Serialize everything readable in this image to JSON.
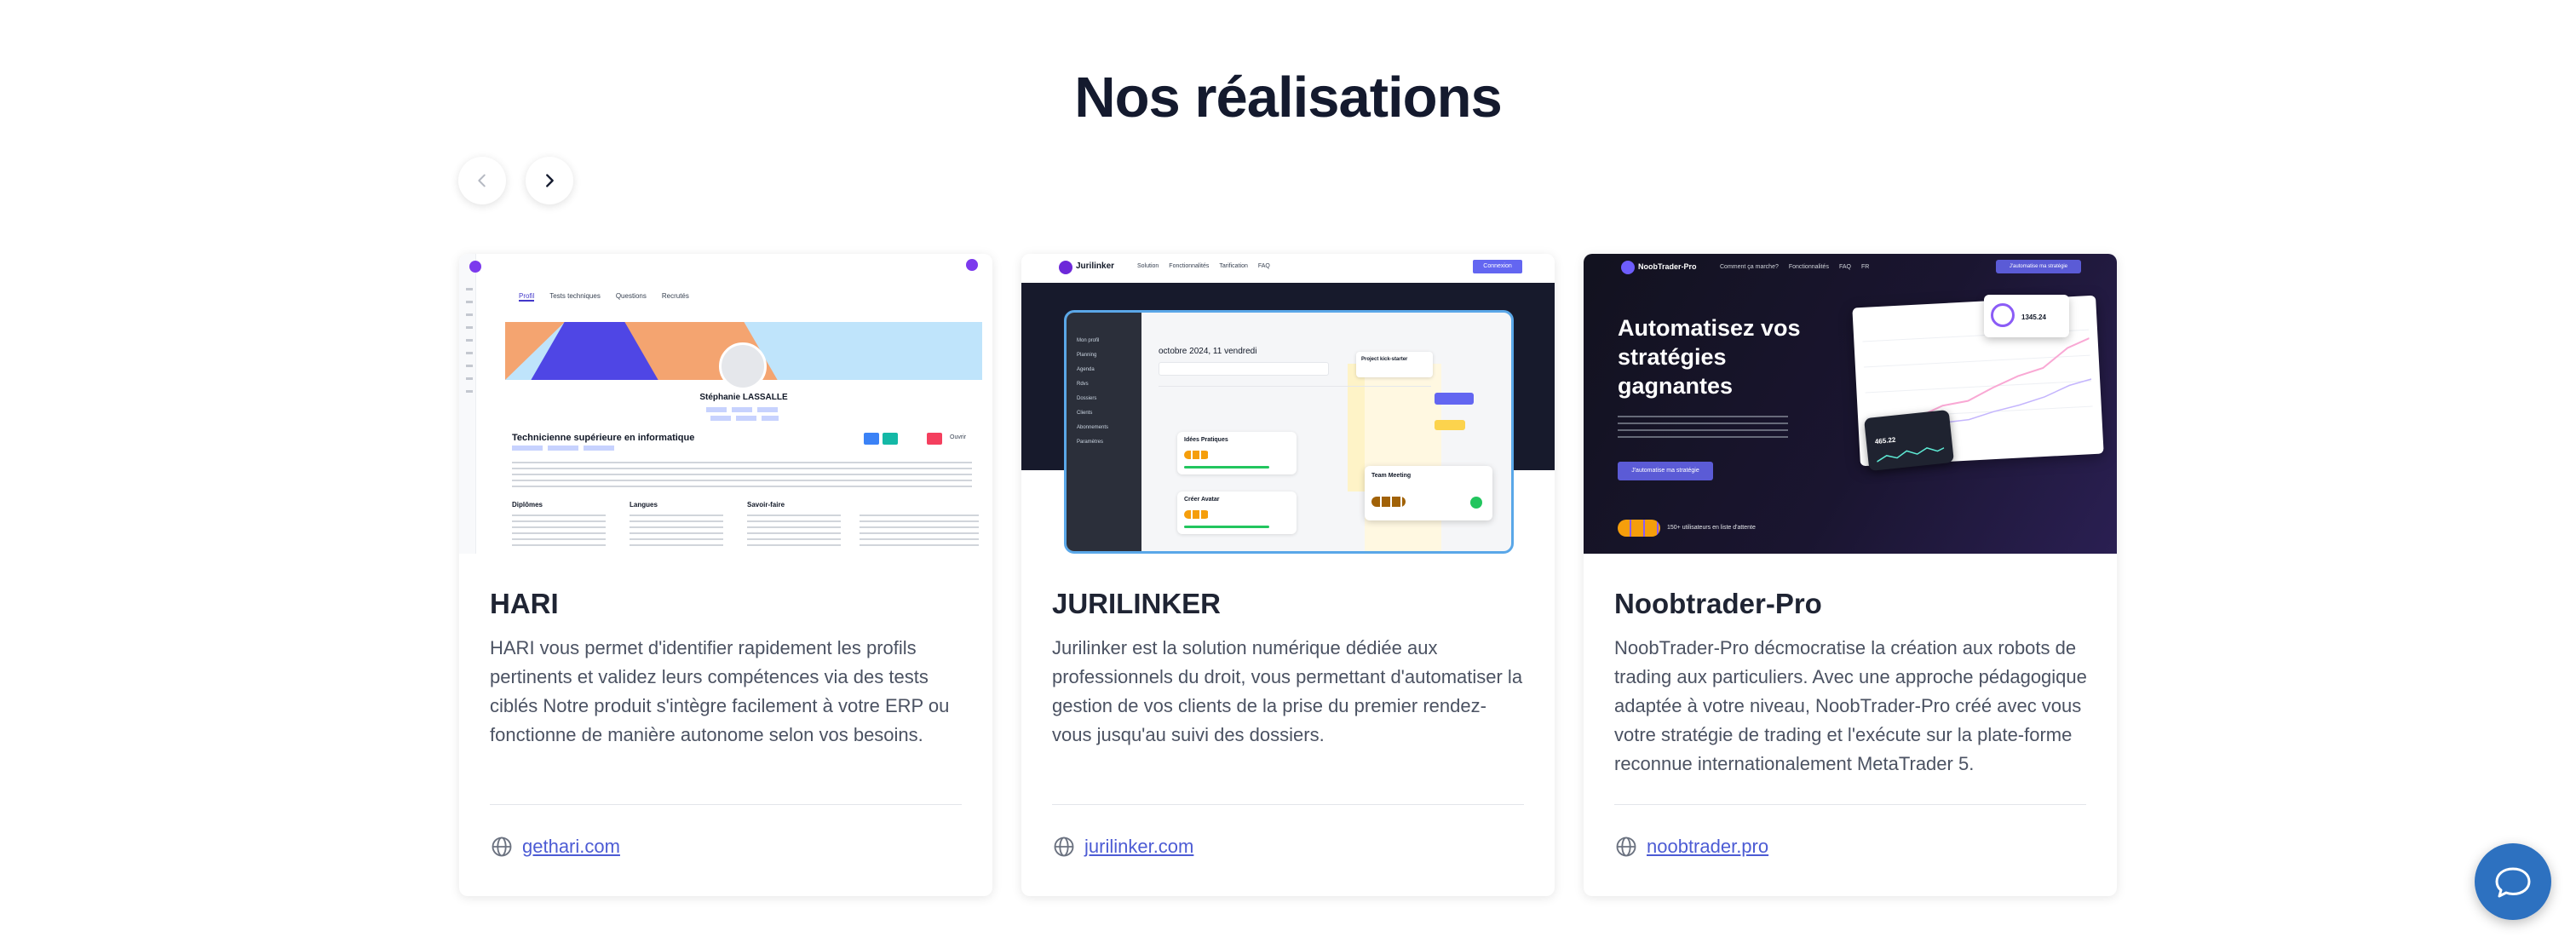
{
  "section": {
    "title": "Nos réalisations"
  },
  "nav": {
    "prev_icon": "chevron-left-icon",
    "next_icon": "chevron-right-icon"
  },
  "cards": [
    {
      "title": "HARI",
      "description": "HARI vous permet d'identifier rapidement les profils pertinents et validez leurs compétences via des tests ciblés Notre produit s'intègre facilement à votre ERP ou fonctionne de manière autonome selon vos besoins.",
      "link": "gethari.com",
      "screenshot": {
        "tabs": [
          "Profil",
          "Tests techniques",
          "Questions",
          "Recrutés"
        ],
        "name": "Stéphanie LASSALLE",
        "role": "Technicienne supérieure en informatique",
        "sections": [
          "Diplômes",
          "Langues",
          "Savoir-faire"
        ],
        "action": "Ouvrir"
      }
    },
    {
      "title": "JURILINKER",
      "description": "Jurilinker est la solution numérique dédiée aux professionnels du droit, vous permettant d'automatiser la gestion de vos clients de la prise du premier rendez-vous jusqu'au suivi des dossiers.",
      "link": "jurilinker.com",
      "screenshot": {
        "brand": "Jurilinker",
        "menu": [
          "Solution",
          "Fonctionnalités",
          "Tarification",
          "FAQ"
        ],
        "cta": "Connexion",
        "date": "octobre 2024, 11 vendredi",
        "events": [
          "Idées Pratiques",
          "Créer Avatar",
          "Team Meeting",
          "Project kick-starter"
        ],
        "sidebar": [
          "Mon profil",
          "Planning",
          "Agenda",
          "Rdvs",
          "Dossiers",
          "Clients",
          "Abonnements",
          "Paramètres"
        ]
      }
    },
    {
      "title": "Noobtrader-Pro",
      "description": "NoobTrader-Pro décmocratise la création aux robots de trading aux particuliers. Avec une approche pédagogique adaptée à votre niveau, NoobTrader-Pro créé avec vous votre stratégie de trading et l'exécute sur la plate-forme reconnue internationalement MetaTrader 5.",
      "link": "noobtrader.pro",
      "screenshot": {
        "brand": "NoobTrader-Pro",
        "menu": [
          "Comment ça marche?",
          "Fonctionnalités",
          "FAQ",
          "FR"
        ],
        "nav_cta": "J'automatise ma stratégie",
        "headline": [
          "Automatisez vos",
          "stratégies",
          "gagnantes"
        ],
        "cta": "J'automatise ma stratégie",
        "badge_value": "1345.24",
        "small_value": "465.22",
        "users": "150+ utilisateurs en liste d'attente"
      }
    }
  ],
  "chat": {
    "icon": "chat-bubble-icon"
  }
}
